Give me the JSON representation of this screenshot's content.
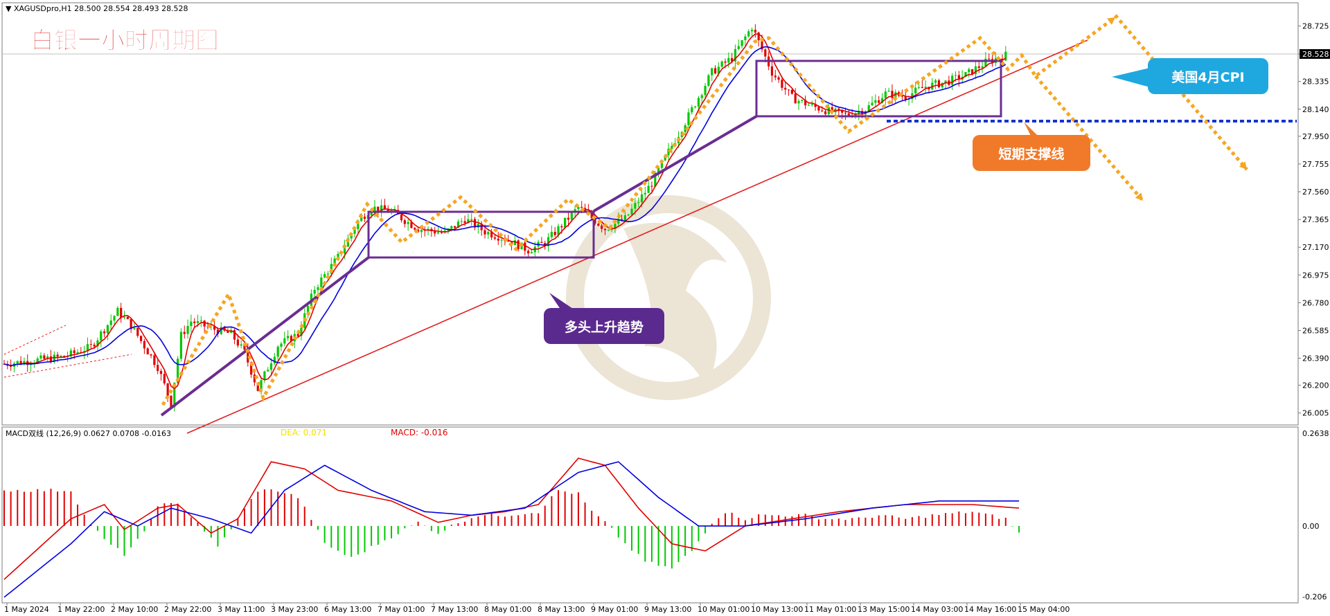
{
  "header": {
    "symbol_line": "▼ XAGUSDpro,H1  28.500 28.554 28.493 28.528",
    "big_title": "白银一小时周期图"
  },
  "callouts": {
    "cpi": "美国4月CPI",
    "support": "短期支撑线",
    "trend": "多头上升趋势"
  },
  "macd_panel": {
    "label": "MACD双线 (12,26,9) 0.0627 0.0708 -0.0163",
    "dea_label": "DEA: 0.071",
    "macd_label": "MACD: -0.016",
    "top_value": "0.2638",
    "zero_value": "0.00",
    "bottom_value": "-0.206"
  },
  "colors": {
    "bull": "#00c800",
    "bear": "#e00000",
    "ma_fast": "#e00000",
    "ma_slow": "#0000e0",
    "arrow": "#f5a623",
    "box": "#6a2d91",
    "support": "#1432d2",
    "cpi_bubble": "#1fa8e0",
    "support_bubble": "#f07a2a",
    "trend_bubble": "#5b2a8e",
    "title_red": "#e01010"
  },
  "chart_data": [
    {
      "type": "candlestick",
      "instrument": "XAGUSDpro",
      "timeframe": "H1",
      "ylim": [
        25.95,
        28.82
      ],
      "y_ticks": [
        "28.725",
        "28.528",
        "28.335",
        "28.140",
        "27.950",
        "27.755",
        "27.560",
        "27.365",
        "27.170",
        "26.975",
        "26.780",
        "26.585",
        "26.390",
        "26.200",
        "26.005"
      ],
      "current_price": "28.528",
      "x_labels": [
        "1 May 2024",
        "1 May 22:00",
        "2 May 10:00",
        "2 May 22:00",
        "3 May 11:00",
        "3 May 23:00",
        "6 May 13:00",
        "7 May 01:00",
        "7 May 13:00",
        "8 May 01:00",
        "8 May 13:00",
        "9 May 01:00",
        "9 May 13:00",
        "10 May 01:00",
        "10 May 13:00",
        "11 May 01:00",
        "13 May 15:00",
        "14 May 03:00",
        "14 May 16:00",
        "15 May 04:00"
      ],
      "price_path": [
        [
          0,
          26.35
        ],
        [
          18,
          26.4
        ],
        [
          26,
          26.47
        ],
        [
          34,
          26.72
        ],
        [
          38,
          26.62
        ],
        [
          46,
          26.33
        ],
        [
          50,
          26.07
        ],
        [
          53,
          26.55
        ],
        [
          56,
          26.65
        ],
        [
          62,
          26.6
        ],
        [
          68,
          26.56
        ],
        [
          72,
          26.43
        ],
        [
          76,
          26.17
        ],
        [
          82,
          26.48
        ],
        [
          88,
          26.56
        ],
        [
          93,
          26.88
        ],
        [
          100,
          27.1
        ],
        [
          106,
          27.35
        ],
        [
          110,
          27.45
        ],
        [
          116,
          27.42
        ],
        [
          124,
          27.3
        ],
        [
          132,
          27.27
        ],
        [
          138,
          27.37
        ],
        [
          144,
          27.28
        ],
        [
          150,
          27.23
        ],
        [
          157,
          27.15
        ],
        [
          162,
          27.2
        ],
        [
          166,
          27.3
        ],
        [
          172,
          27.45
        ],
        [
          180,
          27.3
        ],
        [
          186,
          27.37
        ],
        [
          194,
          27.62
        ],
        [
          198,
          27.8
        ],
        [
          204,
          28.05
        ],
        [
          212,
          28.4
        ],
        [
          218,
          28.5
        ],
        [
          224,
          28.72
        ],
        [
          230,
          28.4
        ],
        [
          236,
          28.22
        ],
        [
          242,
          28.16
        ],
        [
          248,
          28.12
        ],
        [
          252,
          28.1
        ],
        [
          258,
          28.14
        ],
        [
          264,
          28.25
        ],
        [
          270,
          28.23
        ],
        [
          276,
          28.3
        ],
        [
          282,
          28.33
        ],
        [
          288,
          28.38
        ],
        [
          294,
          28.47
        ],
        [
          300,
          28.52
        ],
        [
          306,
          28.58
        ],
        [
          310,
          28.53
        ]
      ]
    },
    {
      "type": "bar",
      "name": "MACD",
      "ylim": [
        -0.206,
        0.2638
      ],
      "histogram": [
        [
          0,
          0.1
        ],
        [
          10,
          0.1
        ],
        [
          20,
          0.1
        ],
        [
          24,
          0.03
        ],
        [
          30,
          -0.04
        ],
        [
          36,
          -0.08
        ],
        [
          42,
          -0.02
        ],
        [
          46,
          0.06
        ],
        [
          52,
          0.06
        ],
        [
          58,
          0.01
        ],
        [
          64,
          -0.06
        ],
        [
          70,
          0.02
        ],
        [
          76,
          0.1
        ],
        [
          82,
          0.1
        ],
        [
          88,
          0.08
        ],
        [
          92,
          0.02
        ],
        [
          96,
          -0.05
        ],
        [
          104,
          -0.09
        ],
        [
          112,
          -0.05
        ],
        [
          118,
          -0.02
        ],
        [
          124,
          0.01
        ],
        [
          130,
          -0.02
        ],
        [
          136,
          0.01
        ],
        [
          142,
          0.03
        ],
        [
          150,
          0.03
        ],
        [
          160,
          0.04
        ],
        [
          166,
          0.1
        ],
        [
          172,
          0.09
        ],
        [
          176,
          0.04
        ],
        [
          180,
          0.01
        ],
        [
          186,
          -0.05
        ],
        [
          192,
          -0.1
        ],
        [
          200,
          -0.12
        ],
        [
          206,
          -0.07
        ],
        [
          212,
          0.01
        ],
        [
          216,
          0.04
        ],
        [
          222,
          0.02
        ],
        [
          226,
          0.03
        ],
        [
          232,
          0.03
        ],
        [
          240,
          0.03
        ],
        [
          246,
          0.02
        ],
        [
          250,
          0.02
        ],
        [
          256,
          0.02
        ],
        [
          262,
          0.03
        ],
        [
          270,
          0.02
        ],
        [
          278,
          0.03
        ],
        [
          290,
          0.04
        ],
        [
          300,
          0.02
        ],
        [
          304,
          -0.02
        ]
      ],
      "macd_line": [
        [
          0,
          -0.15
        ],
        [
          20,
          0.02
        ],
        [
          30,
          0.06
        ],
        [
          36,
          -0.01
        ],
        [
          46,
          0.05
        ],
        [
          52,
          0.06
        ],
        [
          62,
          -0.02
        ],
        [
          70,
          0.02
        ],
        [
          80,
          0.18
        ],
        [
          90,
          0.16
        ],
        [
          100,
          0.1
        ],
        [
          116,
          0.07
        ],
        [
          130,
          0.01
        ],
        [
          140,
          0.03
        ],
        [
          150,
          0.04
        ],
        [
          160,
          0.06
        ],
        [
          172,
          0.19
        ],
        [
          180,
          0.17
        ],
        [
          190,
          0.05
        ],
        [
          200,
          -0.05
        ],
        [
          210,
          -0.07
        ],
        [
          222,
          0.0
        ],
        [
          236,
          0.02
        ],
        [
          250,
          0.04
        ],
        [
          270,
          0.06
        ],
        [
          290,
          0.06
        ],
        [
          304,
          0.05
        ]
      ],
      "signal_line": [
        [
          0,
          -0.2
        ],
        [
          20,
          -0.05
        ],
        [
          30,
          0.04
        ],
        [
          40,
          0.0
        ],
        [
          50,
          0.05
        ],
        [
          62,
          0.02
        ],
        [
          74,
          -0.02
        ],
        [
          84,
          0.1
        ],
        [
          96,
          0.17
        ],
        [
          110,
          0.1
        ],
        [
          126,
          0.04
        ],
        [
          140,
          0.03
        ],
        [
          156,
          0.05
        ],
        [
          172,
          0.15
        ],
        [
          184,
          0.18
        ],
        [
          196,
          0.08
        ],
        [
          208,
          0.0
        ],
        [
          222,
          0.0
        ],
        [
          240,
          0.02
        ],
        [
          260,
          0.05
        ],
        [
          280,
          0.07
        ],
        [
          304,
          0.07
        ]
      ]
    }
  ]
}
